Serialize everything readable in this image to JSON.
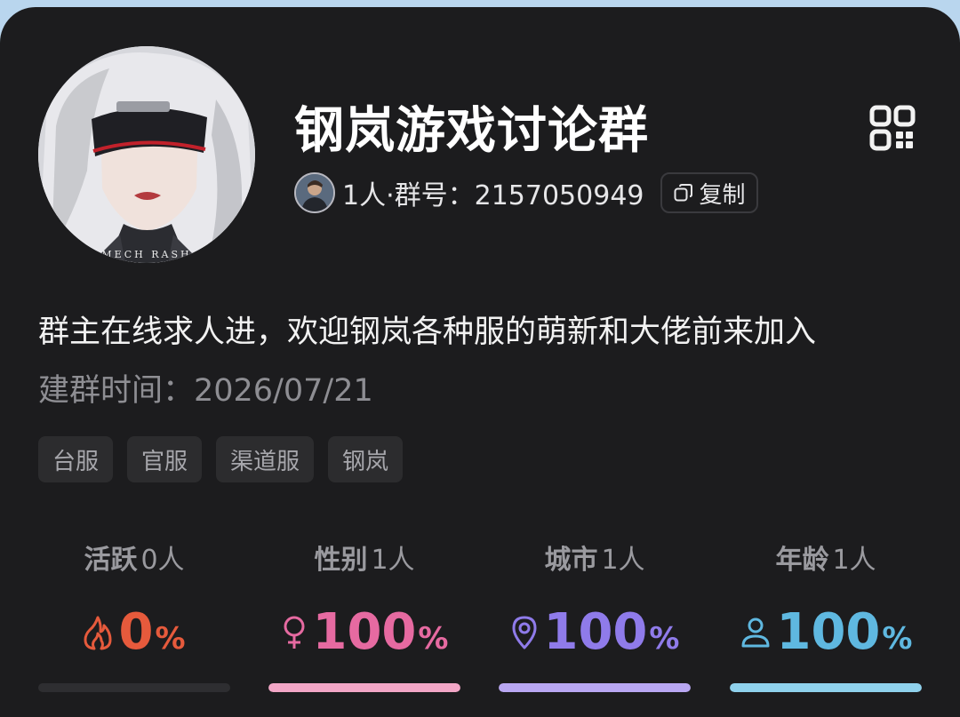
{
  "group": {
    "name": "钢岚游戏讨论群",
    "meta": "1人·群号：2157050949",
    "copy_label": "复制",
    "description": "群主在线求人进，欢迎钢岚各种服的萌新和大佬前来加入",
    "created": "建群时间：2026/07/21",
    "avatar_text": "MECH RASH",
    "tags": [
      "台服",
      "官服",
      "渠道服",
      "钢岚"
    ]
  },
  "stats": [
    {
      "label": "活跃",
      "count": "0人",
      "value": "0",
      "unit": "%",
      "fill_fraction": 0,
      "color": "#e65a3c",
      "icon": "flame-icon"
    },
    {
      "label": "性别",
      "count": "1人",
      "value": "100",
      "unit": "%",
      "fill_fraction": 1,
      "color": "#e66aa1",
      "bar_color": "#f2a6c6",
      "icon": "female-icon"
    },
    {
      "label": "城市",
      "count": "1人",
      "value": "100",
      "unit": "%",
      "fill_fraction": 1,
      "color": "#8f7bea",
      "bar_color": "#b9a7f2",
      "icon": "location-pin-icon"
    },
    {
      "label": "年龄",
      "count": "1人",
      "value": "100",
      "unit": "%",
      "fill_fraction": 1,
      "color": "#5fb8e0",
      "bar_color": "#8fd1ec",
      "icon": "person-icon"
    }
  ]
}
